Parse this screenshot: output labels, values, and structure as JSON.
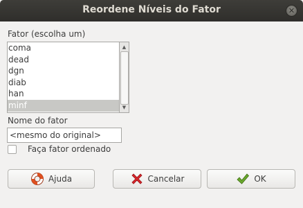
{
  "window": {
    "title": "Reordene Níveis do Fator",
    "close_glyph": "✕"
  },
  "factor_list": {
    "label": "Fator (escolha um)",
    "items": [
      "coma",
      "dead",
      "dgn",
      "diab",
      "han",
      "minf"
    ],
    "selected_item": "minf"
  },
  "factor_name": {
    "label": "Nome do fator",
    "value": "<mesmo do original>"
  },
  "ordered_option": {
    "label": "Faça fator ordenado",
    "checked": false
  },
  "buttons": {
    "help_label": "Ajuda",
    "cancel_label": "Cancelar",
    "ok_label": "OK"
  },
  "icons": {
    "help": "lifebuoy-icon",
    "cancel": "red-x-icon",
    "ok": "green-check-icon"
  },
  "colors": {
    "titlebar": "#2f2e2b",
    "selection": "#c8c8c5",
    "cancel_icon": "#d8262b",
    "ok_icon": "#6aa82d"
  }
}
